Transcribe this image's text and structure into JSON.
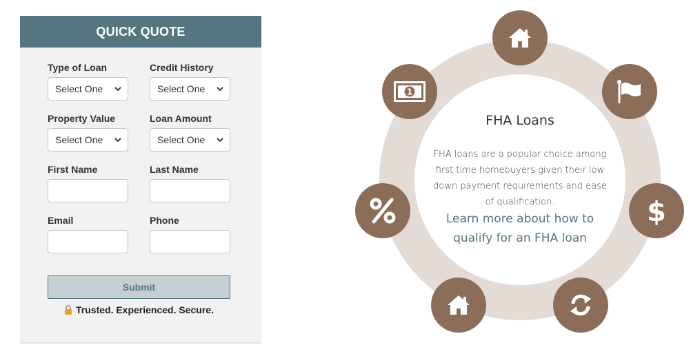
{
  "quote": {
    "title": "QUICK QUOTE",
    "fields": {
      "type_of_loan": {
        "label": "Type of Loan",
        "value": "Select One"
      },
      "credit_history": {
        "label": "Credit History",
        "value": "Select One"
      },
      "property_value": {
        "label": "Property Value",
        "value": "Select One"
      },
      "loan_amount": {
        "label": "Loan Amount",
        "value": "Select One"
      },
      "first_name": {
        "label": "First Name",
        "value": ""
      },
      "last_name": {
        "label": "Last Name",
        "value": ""
      },
      "email": {
        "label": "Email",
        "value": ""
      },
      "phone": {
        "label": "Phone",
        "value": ""
      }
    },
    "submit_label": "Submit",
    "trust_text": "Trusted. Experienced. Secure."
  },
  "fha": {
    "title": "FHA Loans",
    "description": "FHA loans are a popular choice among first time homebuyers given their low down payment requirements and ease of qualification.",
    "link_text": "Learn more about how to qualify for an FHA loan"
  },
  "icons": [
    "home-icon",
    "flag-icon",
    "dollar-icon",
    "refresh-icon",
    "home-icon",
    "percent-icon",
    "money-bill-icon"
  ],
  "colors": {
    "header": "#557680",
    "icon_circle": "#8b6d58",
    "ring": "#e3dbd6",
    "link": "#557680"
  }
}
